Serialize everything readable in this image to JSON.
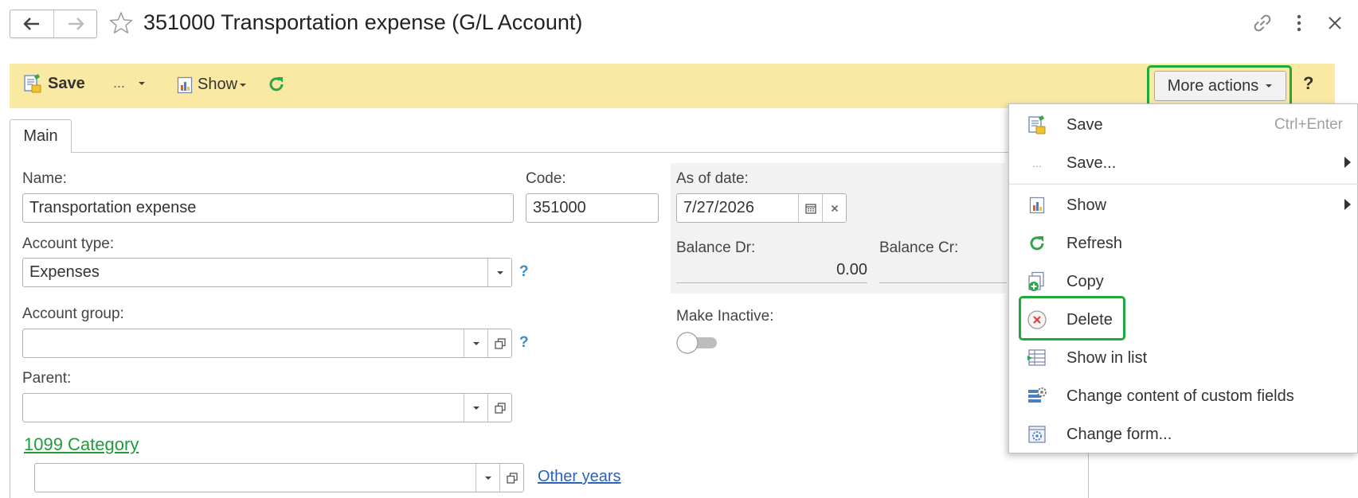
{
  "window": {
    "title": "351000 Transportation expense (G/L Account)",
    "icons": [
      "back-arrow-icon",
      "forward-arrow-icon",
      "star-icon",
      "link-icon",
      "more-vertical-icon",
      "close-icon"
    ]
  },
  "toolbar": {
    "save_label": "Save",
    "more_dots": "...",
    "show_label": "Show",
    "more_actions_label": "More actions",
    "help_label": "?"
  },
  "tabs": [
    {
      "label": "Main",
      "active": true
    }
  ],
  "form": {
    "name": {
      "label": "Name:",
      "value": "Transportation expense"
    },
    "code": {
      "label": "Code:",
      "value": "351000"
    },
    "as_of_date": {
      "label": "As of date:",
      "value": "7/27/2026"
    },
    "balance_dr": {
      "label": "Balance Dr:",
      "value": "0.00"
    },
    "balance_cr": {
      "label": "Balance Cr:",
      "value": ""
    },
    "account_type": {
      "label": "Account type:",
      "value": "Expenses",
      "help": "?"
    },
    "account_group": {
      "label": "Account group:",
      "value": "",
      "help": "?"
    },
    "make_inactive": {
      "label": "Make Inactive:",
      "on": false
    },
    "parent": {
      "label": "Parent:",
      "value": ""
    },
    "category_1099": {
      "label": "1099 Category ",
      "value": ""
    },
    "other_years_link": "Other years"
  },
  "menu": {
    "items": [
      {
        "label": "Save",
        "shortcut": "Ctrl+Enter",
        "icon": "save-icon"
      },
      {
        "label": "Save...",
        "icon": "dots-icon",
        "submenu": true
      },
      {
        "label": "Show",
        "icon": "report-icon",
        "submenu": true
      },
      {
        "label": "Refresh",
        "icon": "refresh-icon"
      },
      {
        "label": "Copy",
        "icon": "copy-icon"
      },
      {
        "label": "Delete",
        "icon": "delete-icon",
        "highlighted": true
      },
      {
        "label": "Show in list",
        "icon": "list-icon"
      },
      {
        "label": "Change content of custom fields",
        "icon": "custom-fields-icon"
      },
      {
        "label": "Change form...",
        "icon": "form-settings-icon"
      }
    ]
  },
  "colors": {
    "toolbar_bg": "#fae9a2",
    "highlight": "#1fa83b",
    "link_green": "#1f9c3a",
    "link_blue": "#2a63b8",
    "help_blue": "#3a8cc9"
  }
}
